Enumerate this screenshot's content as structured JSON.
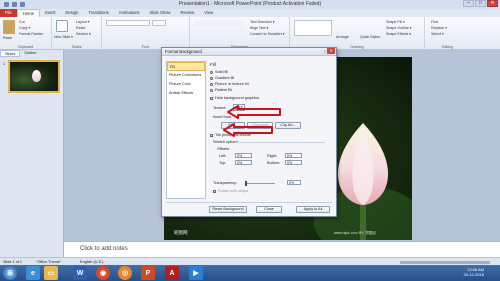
{
  "window": {
    "title": "Presentation1 - Microsoft PowerPoint (Product Activation Failed)",
    "controls": [
      "–",
      "□",
      "✕"
    ]
  },
  "tabs": [
    "File",
    "Home",
    "Insert",
    "Design",
    "Transitions",
    "Animations",
    "Slide Show",
    "Review",
    "View"
  ],
  "ribbon": {
    "clipboard": {
      "paste": "Paste",
      "cut": "Cut",
      "copy": "Copy ▾",
      "format_painter": "Format Painter",
      "label": "Clipboard"
    },
    "slides": {
      "new_slide": "New Slide ▾",
      "layout": "Layout ▾",
      "reset": "Reset",
      "section": "Section ▾",
      "label": "Slides"
    },
    "font": {
      "label": "Font"
    },
    "paragraph": {
      "text_direction": "Text Direction ▾",
      "align_text": "Align Text ▾",
      "smartart": "Convert to SmartArt ▾",
      "label": "Paragraph"
    },
    "drawing": {
      "shapes": "Shapes",
      "arrange": "Arrange",
      "quick_styles": "Quick Styles",
      "shape_fill": "Shape Fill ▾",
      "shape_outline": "Shape Outline ▾",
      "shape_effects": "Shape Effects ▾",
      "label": "Drawing"
    },
    "editing": {
      "find": "Find",
      "replace": "Replace ▾",
      "select": "Select ▾",
      "label": "Editing"
    }
  },
  "left_pane": {
    "tabs": [
      "Slides",
      "Outline"
    ],
    "slide_number": "1"
  },
  "slide": {
    "watermark": "昵图网",
    "watermark_url": "www.nipic.com",
    "watermark_by": "BY: 郑国民"
  },
  "notes": {
    "placeholder": "Click to add notes"
  },
  "statusbar": {
    "slide_info": "Slide 1 of 1",
    "theme": "\"Office Theme\"",
    "language": "English (U.S.)"
  },
  "taskbar": {
    "time": "12:08 AM",
    "date": "30-12-2016"
  },
  "dialog": {
    "title": "Format Background",
    "help": "?",
    "close": "✕",
    "nav": [
      "Fill",
      "Picture Corrections",
      "Picture Color",
      "Artistic Effects"
    ],
    "fill_header": "Fill",
    "options": [
      "Solid fill",
      "Gradient fill",
      "Picture or texture fill",
      "Pattern fill"
    ],
    "hide_graphics": "Hide background graphics",
    "texture_label": "Texture:",
    "insert_from": "Insert from:",
    "file_button": "File...",
    "clipboard_button": "Clipboard",
    "clip_art_button": "Clip Art...",
    "tile_label": "Tile picture as texture",
    "stretch_options": "Stretch options",
    "offsets": "Offsets:",
    "left_label": "Left:",
    "left_value": "0%",
    "right_label": "Right:",
    "right_value": "0%",
    "top_label": "Top:",
    "top_value": "0%",
    "bottom_label": "Bottom:",
    "bottom_value": "0%",
    "transparency_label": "Transparency:",
    "transparency_value": "0%",
    "rotate_label": "Rotate with shape",
    "reset_button": "Reset Background",
    "close_button": "Close",
    "apply_all_button": "Apply to All"
  },
  "colors": {
    "file_tab": "#c43d2a",
    "accent": "#e8b04a",
    "arrow": "#d0101a"
  }
}
